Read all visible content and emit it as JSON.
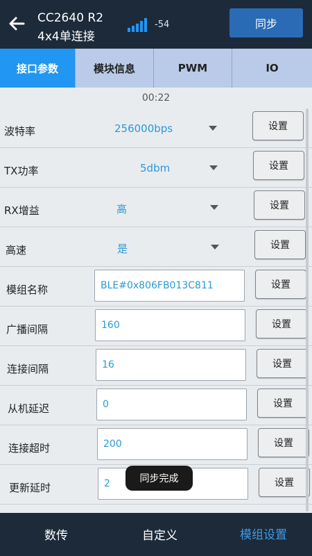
{
  "header": {
    "device_name": "CC2640 R2",
    "connection_mode": "4x4单连接",
    "rssi": "-54",
    "sync_label": "同步"
  },
  "tabs": [
    {
      "label": "接口参数",
      "active": true
    },
    {
      "label": "模块信息",
      "active": false
    },
    {
      "label": "PWM",
      "active": false
    },
    {
      "label": "IO",
      "active": false
    }
  ],
  "timer": "00:22",
  "rows": [
    {
      "label": "波特率",
      "value": "256000bps",
      "button": "设置"
    },
    {
      "label": "TX功率",
      "value": "5dbm",
      "button": "设置"
    },
    {
      "label": "RX增益",
      "value": "高",
      "button": "设置"
    },
    {
      "label": "高速",
      "value": "是",
      "button": "设置"
    },
    {
      "label": "模组名称",
      "value": "BLE#0x806FB013C811",
      "button": "设置"
    },
    {
      "label": "广播间隔",
      "value": "160",
      "button": "设置"
    },
    {
      "label": "连接间隔",
      "value": "16",
      "button": "设置"
    },
    {
      "label": "从机延迟",
      "value": "0",
      "button": "设置"
    },
    {
      "label": "连接超时",
      "value": "200",
      "button": "设置"
    },
    {
      "label": "更新延时",
      "value": "2",
      "button": "设置"
    }
  ],
  "toast": "同步完成",
  "bottom_nav": [
    {
      "label": "数传",
      "active": false
    },
    {
      "label": "自定义",
      "active": false
    },
    {
      "label": "模组设置",
      "active": true
    }
  ],
  "colors": {
    "appbar": "#1c2a3a",
    "accent": "#2196f3",
    "value_text": "#2b9ad6",
    "tab_inactive": "#b9cbe8"
  }
}
